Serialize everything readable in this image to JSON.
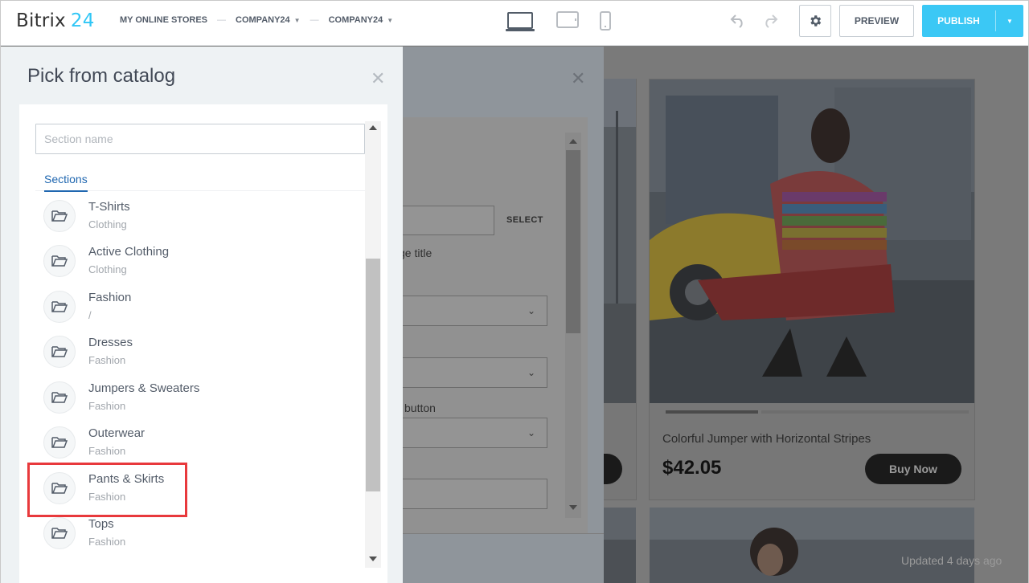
{
  "app": {
    "logo_text": "Bitrix",
    "logo_num": "24",
    "accent": "#2fc6f6"
  },
  "breadcrumbs": [
    {
      "label": "MY ONLINE STORES"
    },
    {
      "label": "COMPANY24"
    },
    {
      "label": "COMPANY24"
    }
  ],
  "toolbar": {
    "devices": [
      "desktop-icon",
      "tablet-icon",
      "mobile-icon"
    ],
    "settings_icon": "gear-icon",
    "preview_label": "PREVIEW",
    "publish_label": "PUBLISH",
    "publish_color": "#3bc8f5"
  },
  "catalog_panel": {
    "title": "Pick from catalog",
    "search_placeholder": "Section name",
    "tab_label": "Sections",
    "items": [
      {
        "name": "T-Shirts",
        "parent": "Clothing"
      },
      {
        "name": "Active Clothing",
        "parent": "Clothing"
      },
      {
        "name": "Fashion",
        "parent": "/"
      },
      {
        "name": "Dresses",
        "parent": "Fashion"
      },
      {
        "name": "Jumpers & Sweaters",
        "parent": "Fashion"
      },
      {
        "name": "Outerwear",
        "parent": "Fashion"
      },
      {
        "name": "Pants & Skirts",
        "parent": "Fashion"
      },
      {
        "name": "Tops",
        "parent": "Fashion"
      }
    ],
    "highlighted_item": "Pants & Skirts"
  },
  "settings_panel": {
    "select_label": "SELECT",
    "field_labels": [
      "ge title",
      "button"
    ]
  },
  "product": {
    "title": "Colorful Jumper with Horizontal Stripes",
    "price": "$42.05",
    "buy_label": "Buy Now",
    "updated": "Updated 4 days ago"
  }
}
